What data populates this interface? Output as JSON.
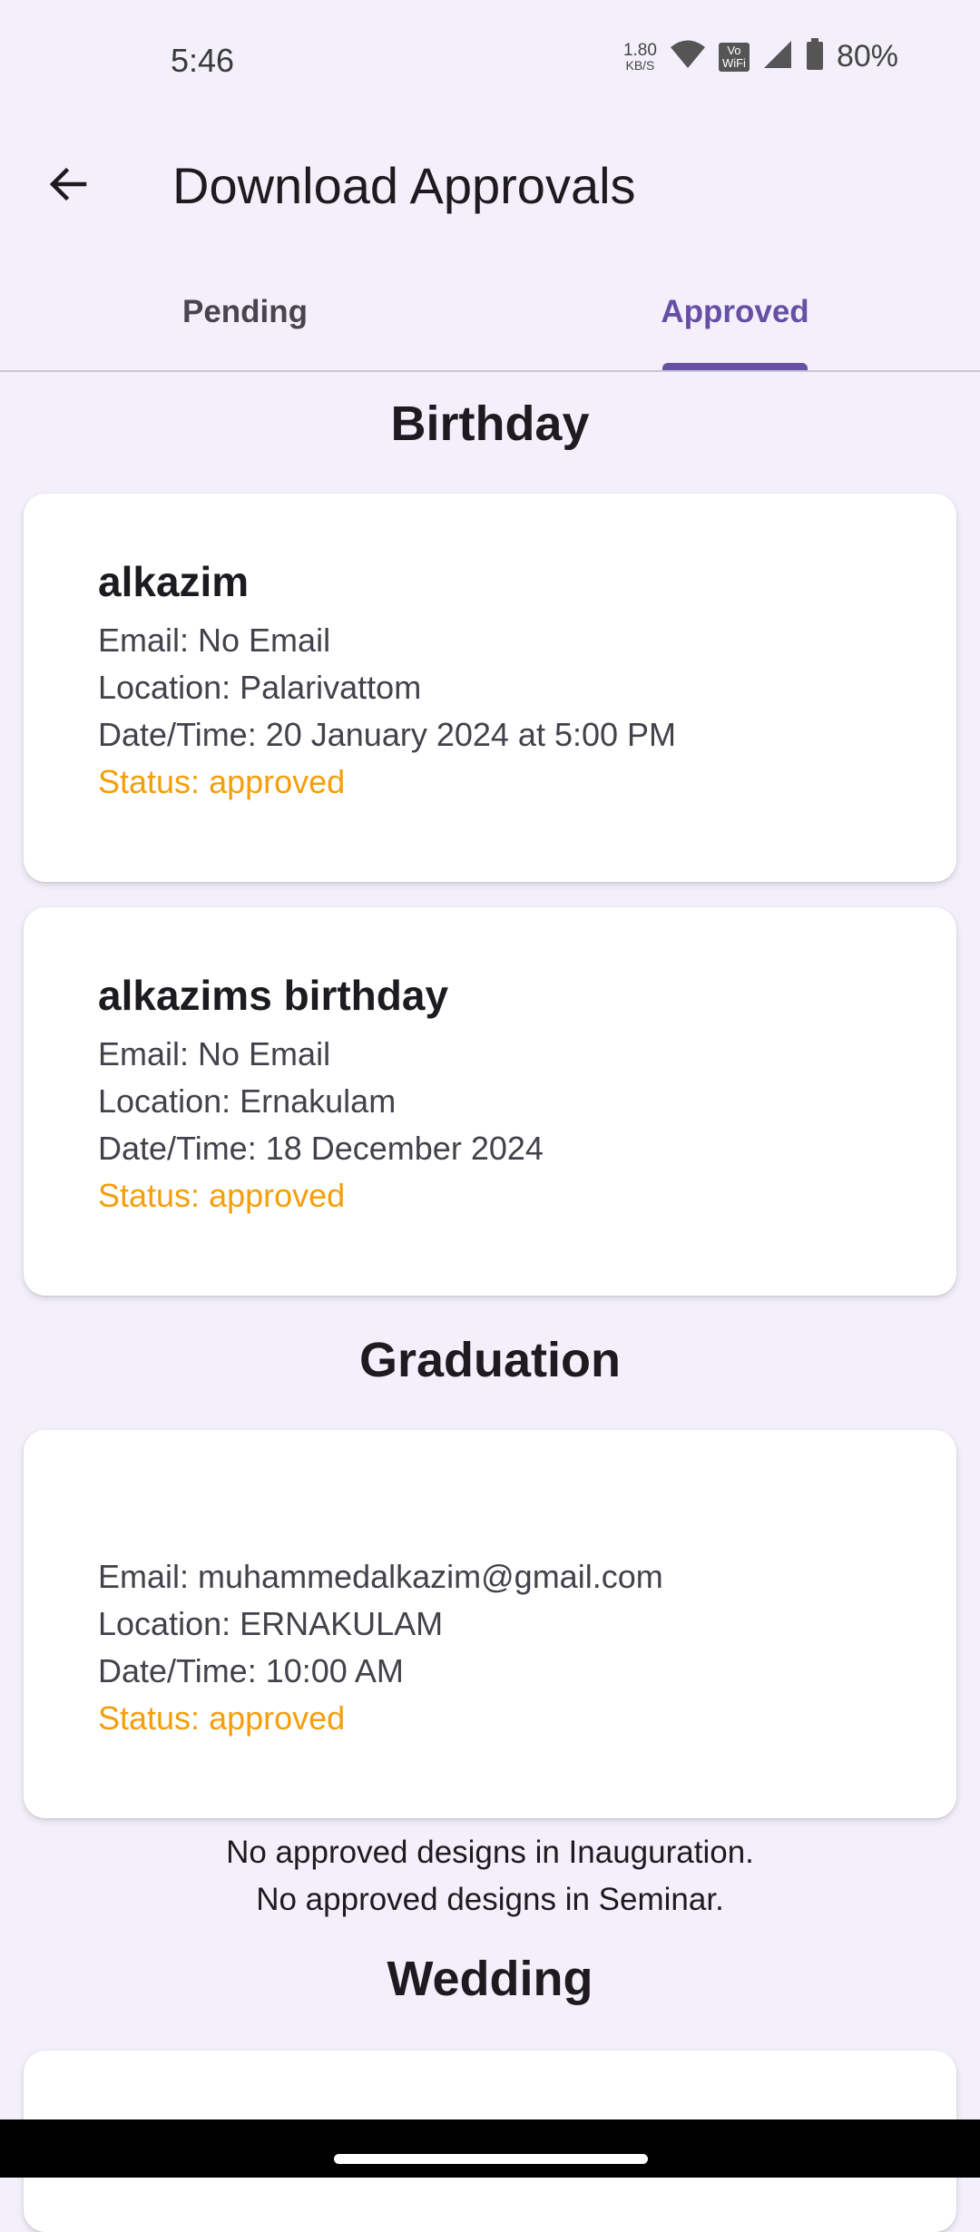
{
  "status_bar": {
    "time": "5:46",
    "net_speed_value": "1.80",
    "net_speed_unit": "KB/S",
    "vowifi_label": "Vo\nWiFi",
    "battery": "80%"
  },
  "app_bar": {
    "title": "Download Approvals"
  },
  "tabs": [
    {
      "label": "Pending",
      "selected": false
    },
    {
      "label": "Approved",
      "selected": true
    }
  ],
  "colors": {
    "accent": "#6750a4",
    "status_approved": "#f59e0b",
    "background": "#f3f0fc"
  },
  "sections": {
    "birthday": {
      "title": "Birthday",
      "items": [
        {
          "name": "alkazim",
          "email": "Email: No Email",
          "location": "Location: Palarivattom",
          "datetime": "Date/Time: 20 January 2024 at 5:00 PM",
          "status": "Status: approved"
        },
        {
          "name": "alkazims birthday",
          "email": "Email: No Email",
          "location": "Location: Ernakulam",
          "datetime": "Date/Time: 18 December 2024",
          "status": "Status: approved"
        }
      ]
    },
    "graduation": {
      "title": "Graduation",
      "items": [
        {
          "name": "",
          "email": "Email: muhammedalkazim@gmail.com",
          "location": "Location: ERNAKULAM",
          "datetime": "Date/Time: 10:00 AM",
          "status": "Status: approved"
        }
      ]
    },
    "messages": [
      "No approved designs in Inauguration.",
      "No approved designs in Seminar."
    ],
    "wedding": {
      "title": "Wedding"
    }
  }
}
